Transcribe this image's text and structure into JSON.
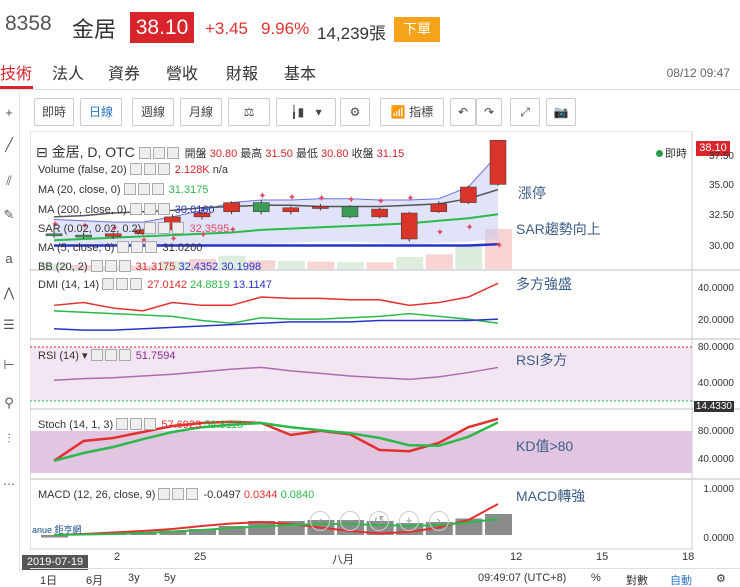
{
  "header": {
    "code": "8358",
    "name": "金居",
    "price": "38.10",
    "change": "+3.45",
    "change_pct": "9.96%",
    "volume": "14,239張",
    "order_label": "下單"
  },
  "tabs": {
    "items": [
      "技術",
      "法人",
      "資券",
      "營收",
      "財報",
      "基本"
    ],
    "active": "技術",
    "datetime": "08/12 09:47"
  },
  "toolbar": {
    "intraday": "即時",
    "daily": "日線",
    "weekly": "週線",
    "monthly": "月線",
    "indicators": "指標"
  },
  "chart": {
    "title": "金居, D, OTC",
    "ohlc": {
      "open_label": "開盤",
      "open": "30.80",
      "high_label": "最高",
      "high": "31.50",
      "low_label": "最低",
      "low": "30.80",
      "close_label": "收盤",
      "close": "31.15"
    },
    "live_label": "即時",
    "last_price": "38.10",
    "legends": {
      "volume": {
        "label": "Volume (false, 20)",
        "v1": "2.128K",
        "v2": "n/a"
      },
      "ma20": {
        "label": "MA (20, close, 0)",
        "v": "31.3175"
      },
      "ma200": {
        "label": "MA (200, close, 0)",
        "v": "30.0160"
      },
      "sar": {
        "label": "SAR (0.02, 0.02, 0.2)",
        "v": "32.3595"
      },
      "ma5": {
        "label": "MA (5, close, 0)",
        "v": "31.0200"
      },
      "bb": {
        "label": "BB (20, 2)",
        "v1": "31.3175",
        "v2": "32.4352",
        "v3": "30.1998"
      },
      "dmi": {
        "label": "DMI (14, 14)",
        "v1": "27.0142",
        "v2": "24.8819",
        "v3": "13.1147"
      },
      "rsi": {
        "label": "RSI (14)",
        "v": "51.7594"
      },
      "stoch": {
        "label": "Stoch (14, 1, 3)",
        "v1": "57.6923",
        "v2": "58.8118"
      },
      "macd": {
        "label": "MACD (12, 26, close, 9)",
        "v1": "-0.0497",
        "v2": "0.0344",
        "v3": "0.0840"
      }
    },
    "annotations": {
      "limit_up": "漲停",
      "sar": "SAR趨勢向上",
      "dmi": "多方強盛",
      "rsi": "RSI多方",
      "kd": "KD值>80",
      "macd": "MACD轉強"
    },
    "price_axis": [
      "37.50",
      "35.00",
      "32.50",
      "30.00"
    ],
    "dmi_axis": [
      "40.0000",
      "20.0000"
    ],
    "rsi_axis": [
      "80.0000",
      "40.0000",
      "14.4330"
    ],
    "stoch_axis": [
      "80.0000",
      "40.0000"
    ],
    "macd_axis": [
      "1.0000",
      "0.0000"
    ],
    "x_ticks": [
      "2019-07-19",
      "2",
      "25",
      "八月",
      "6",
      "12",
      "15",
      "18"
    ],
    "logo": "anue 鉅亨網"
  },
  "chart_data": {
    "type": "candlestick",
    "candles": [
      {
        "o": 30.9,
        "h": 31.1,
        "l": 30.6,
        "c": 30.8
      },
      {
        "o": 30.8,
        "h": 31.0,
        "l": 30.5,
        "c": 30.7
      },
      {
        "o": 30.7,
        "h": 31.0,
        "l": 30.5,
        "c": 30.9
      },
      {
        "o": 30.9,
        "h": 31.3,
        "l": 30.8,
        "c": 31.2
      },
      {
        "o": 31.2,
        "h": 32.4,
        "l": 31.0,
        "c": 32.2
      },
      {
        "o": 32.2,
        "h": 32.9,
        "l": 32.0,
        "c": 32.5
      },
      {
        "o": 32.6,
        "h": 33.4,
        "l": 32.4,
        "c": 33.3
      },
      {
        "o": 33.3,
        "h": 33.5,
        "l": 32.4,
        "c": 32.6
      },
      {
        "o": 32.6,
        "h": 33.0,
        "l": 32.4,
        "c": 32.9
      },
      {
        "o": 32.9,
        "h": 33.2,
        "l": 32.7,
        "c": 33.0
      },
      {
        "o": 33.0,
        "h": 33.1,
        "l": 32.1,
        "c": 32.2
      },
      {
        "o": 32.2,
        "h": 32.9,
        "l": 32.1,
        "c": 32.8
      },
      {
        "o": 30.5,
        "h": 32.6,
        "l": 30.3,
        "c": 32.5
      },
      {
        "o": 32.6,
        "h": 33.4,
        "l": 32.5,
        "c": 33.2
      },
      {
        "o": 33.3,
        "h": 34.6,
        "l": 33.2,
        "c": 34.5
      },
      {
        "o": 34.7,
        "h": 38.1,
        "l": 34.6,
        "c": 38.1
      }
    ],
    "ma20": [
      30.4,
      30.5,
      30.6,
      30.7,
      30.8,
      30.9,
      31.0,
      31.2,
      31.3,
      31.4,
      31.5,
      31.6,
      31.7,
      31.9,
      32.1,
      32.4
    ],
    "ma200": [
      30.0,
      30.0,
      30.0,
      30.0,
      30.0,
      30.0,
      30.0,
      30.0,
      30.0,
      30.0,
      30.0,
      30.0,
      30.0,
      30.0,
      30.0,
      30.1
    ],
    "sar": [
      31.6,
      31.5,
      31.3,
      30.4,
      30.5,
      30.8,
      31.2,
      33.8,
      33.7,
      33.6,
      33.5,
      33.4,
      33.6,
      31.0,
      31.4,
      30.0
    ],
    "ma5": [
      32.2,
      32.3,
      32.5,
      32.6,
      32.7,
      32.9,
      33.0,
      33.1,
      33.1,
      33.0,
      33.0,
      33.0,
      33.1,
      33.2,
      33.6,
      34.3
    ],
    "bb_upper": [
      32.0,
      31.9,
      31.8,
      31.8,
      32.2,
      32.7,
      33.3,
      33.5,
      33.5,
      33.6,
      33.6,
      33.5,
      33.5,
      33.6,
      34.5,
      37.0
    ],
    "bb_lower": [
      30.2,
      30.1,
      30.1,
      30.1,
      30.0,
      30.0,
      30.0,
      30.1,
      30.2,
      30.3,
      30.3,
      30.2,
      30.1,
      30.2,
      30.3,
      30.5
    ],
    "volume": [
      0.8,
      0.6,
      0.5,
      0.5,
      1.2,
      1.5,
      2.0,
      1.3,
      1.2,
      1.1,
      1.0,
      1.0,
      1.8,
      2.2,
      3.5,
      6.0
    ],
    "dmi_plus": [
      30,
      32,
      28,
      26,
      32,
      30,
      30,
      36,
      35,
      35,
      34,
      34,
      30,
      32,
      36,
      46
    ],
    "dmi_minus": [
      26,
      25,
      24,
      23,
      22,
      19,
      17,
      21,
      20,
      20,
      21,
      22,
      24,
      22,
      20,
      17
    ],
    "adx": [
      13,
      12,
      12,
      13,
      14,
      15,
      16,
      17,
      18,
      18,
      18,
      19,
      19,
      19,
      19,
      20
    ],
    "rsi": [
      45,
      47,
      48,
      50,
      52,
      55,
      58,
      60,
      56,
      53,
      50,
      48,
      46,
      49,
      54,
      60
    ],
    "stoch_k": [
      22,
      55,
      60,
      70,
      80,
      85,
      87,
      85,
      65,
      72,
      66,
      40,
      38,
      52,
      78,
      92
    ],
    "stoch_d": [
      22,
      35,
      45,
      58,
      70,
      78,
      82,
      85,
      78,
      73,
      68,
      60,
      48,
      47,
      62,
      86
    ],
    "macd": [
      0.0,
      0.02,
      0.05,
      0.08,
      0.12,
      0.18,
      0.23,
      0.26,
      0.22,
      0.15,
      0.08,
      0.03,
      0.06,
      0.15,
      0.3,
      0.62
    ],
    "macd_signal": [
      0.0,
      0.01,
      0.02,
      0.04,
      0.07,
      0.1,
      0.14,
      0.17,
      0.2,
      0.22,
      0.22,
      0.2,
      0.18,
      0.2,
      0.25,
      0.32
    ],
    "macd_hist": [
      -0.05,
      0.02,
      0.04,
      0.06,
      0.09,
      0.12,
      0.18,
      0.28,
      0.28,
      0.3,
      0.3,
      0.28,
      0.24,
      0.26,
      0.33,
      0.42
    ],
    "price_ylim": [
      28.5,
      38.5
    ]
  },
  "bottom": {
    "ranges": [
      "1日",
      "6月",
      "3y",
      "5y"
    ],
    "clock": "09:49:07 (UTC+8)",
    "pct": "%",
    "log": "對數",
    "auto": "自動"
  }
}
